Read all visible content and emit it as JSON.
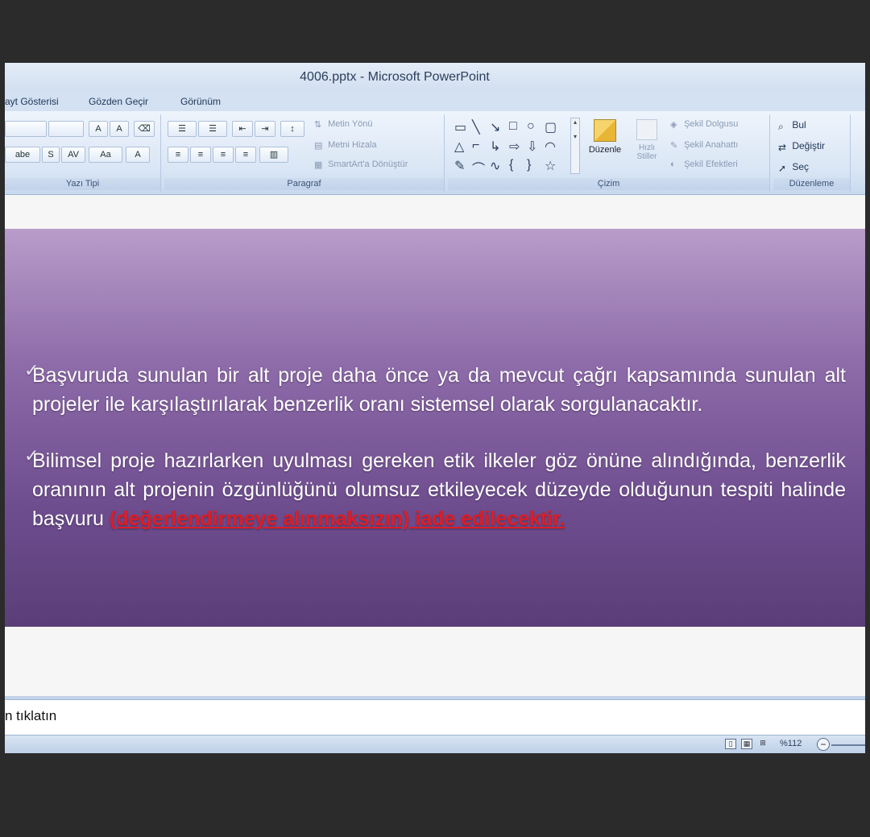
{
  "window": {
    "title": "4006.pptx - Microsoft PowerPoint"
  },
  "tabs": [
    {
      "label": "ayt Gösterisi"
    },
    {
      "label": "Gözden Geçir"
    },
    {
      "label": "Görünüm"
    }
  ],
  "ribbon": {
    "font_group": {
      "label": "Yazı Tipi",
      "grow_font": "A",
      "shrink_font": "A",
      "strike": "abe",
      "shadow": "S",
      "spacing": "AV",
      "change_case": "Aa",
      "font_color": "A"
    },
    "paragraph_group": {
      "label": "Paragraf",
      "text_direction": "Metin Yönü",
      "align_text": "Metni Hizala",
      "smartart": "SmartArt'a Dönüştür"
    },
    "drawing_group": {
      "label": "Çizim",
      "arrange": "Düzenle",
      "quick_styles_1": "Hızlı",
      "quick_styles_2": "Stiller",
      "shape_fill": "Şekil Dolgusu",
      "shape_outline": "Şekil Anahattı",
      "shape_effects": "Şekil Efektleri"
    },
    "editing_group": {
      "label": "Düzenleme",
      "find": "Bul",
      "replace": "Değiştir",
      "select": "Seç"
    }
  },
  "slide": {
    "bullet1": "Başvuruda sunulan bir alt proje daha önce ya da mevcut çağrı kapsamında sunulan alt projeler ile karşılaştırılarak benzerlik oranı sistemsel olarak sorgulanacaktır.",
    "bullet2_main": "Bilimsel proje hazırlarken uyulması gereken etik ilkeler göz önüne alındığında, benzerlik oranının alt projenin özgünlüğünü olumsuz etkileyecek düzeyde olduğunun tespiti halinde başvuru ",
    "bullet2_highlight": "(değerlendirmeye alınmaksızın) iade edilecektir."
  },
  "notes": {
    "placeholder": "n tıklatın"
  },
  "status": {
    "zoom": "%112"
  },
  "colors": {
    "slide_top": "#b89cca",
    "slide_bottom": "#5a3e78",
    "highlight": "#e01c24"
  }
}
